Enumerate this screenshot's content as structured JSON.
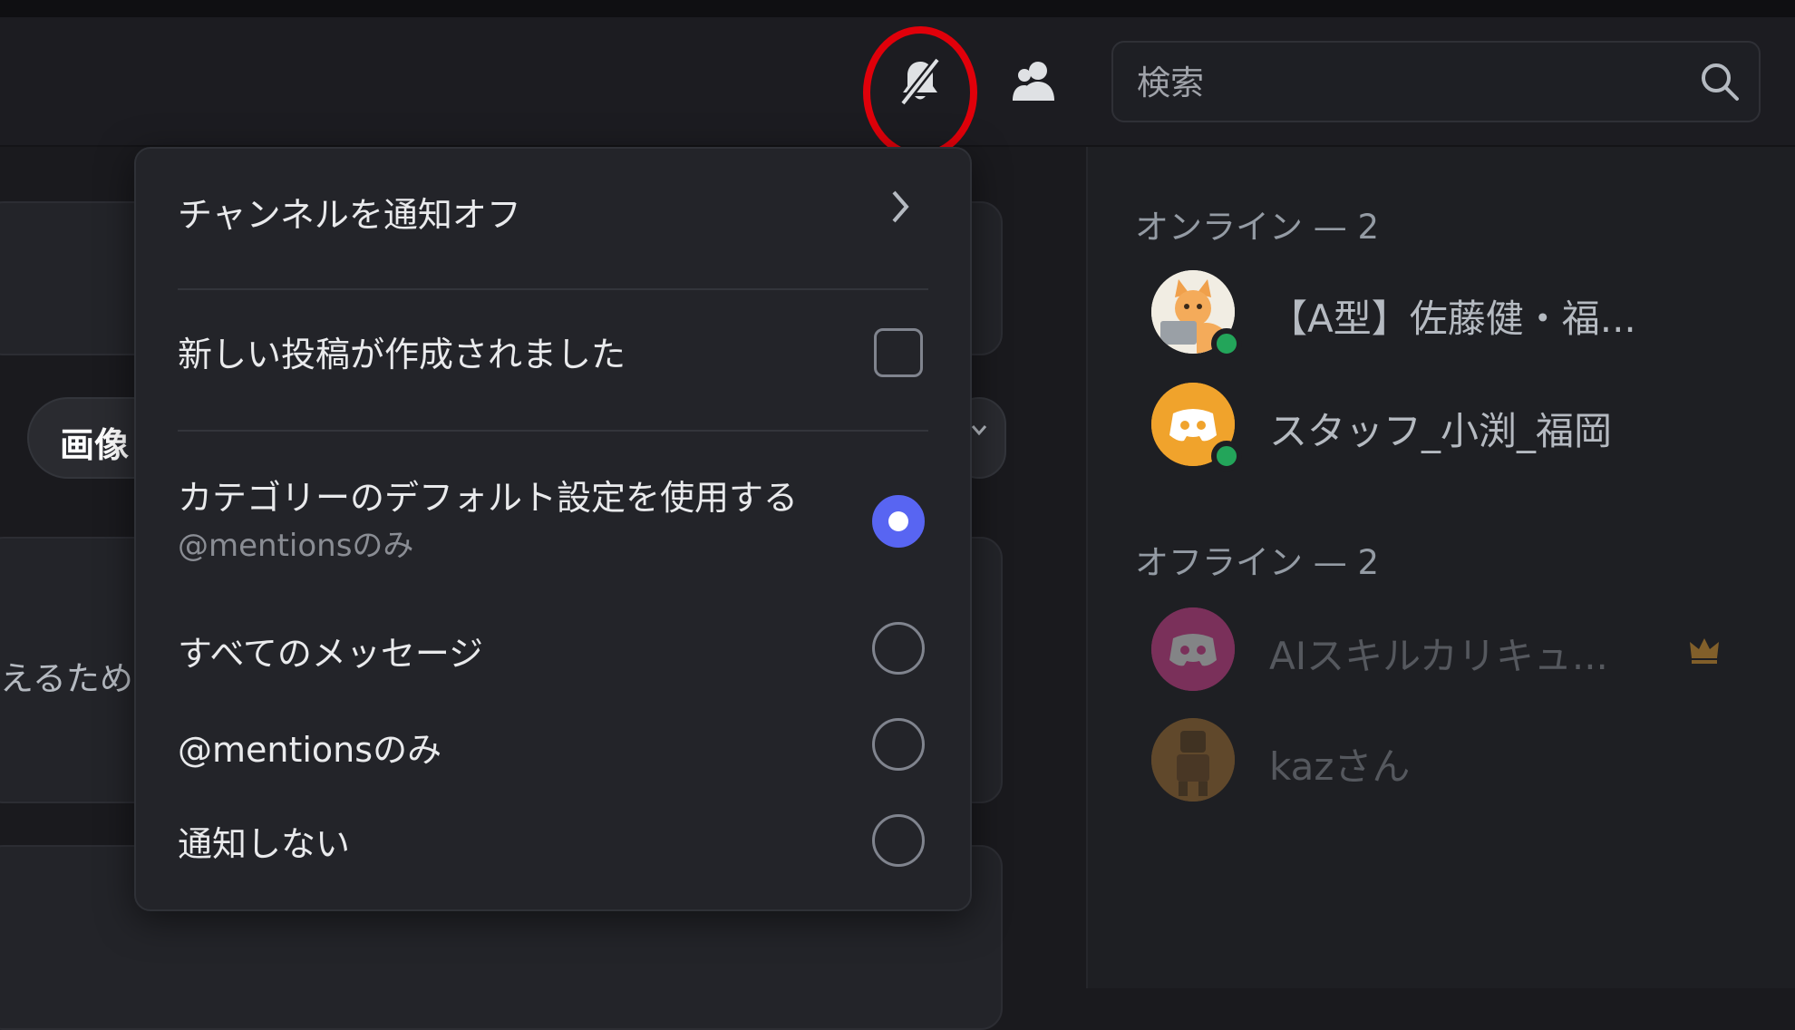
{
  "header": {
    "search_placeholder": "検索"
  },
  "main": {
    "chip_label": "画像",
    "peek_text": "えるため"
  },
  "menu": {
    "items": [
      {
        "label": "チャンネルを通知オフ",
        "type": "submenu"
      },
      {
        "label": "新しい投稿が作成されました",
        "type": "checkbox",
        "checked": false
      },
      {
        "label": "カテゴリーのデフォルト設定を使用する",
        "sublabel": "@mentionsのみ",
        "type": "radio",
        "checked": true
      },
      {
        "label": "すべてのメッセージ",
        "type": "radio",
        "checked": false
      },
      {
        "label": "@mentionsのみ",
        "type": "radio",
        "checked": false
      },
      {
        "label": "通知しない",
        "type": "radio",
        "checked": false
      }
    ]
  },
  "sidebar": {
    "online_label": "オンライン — 2",
    "offline_label": "オフライン — 2",
    "online_members": [
      {
        "name": "【A型】佐藤健・福...",
        "status": "online"
      },
      {
        "name": "スタッフ_小渕_福岡",
        "status": "online"
      }
    ],
    "offline_members": [
      {
        "name": "AIスキルカリキュ...",
        "owner": true
      },
      {
        "name": "kazさん"
      }
    ]
  },
  "colors": {
    "accent": "#5865f2",
    "online": "#23a55a",
    "highlight_ring": "#e0000a",
    "discord_orange": "#f0a32c",
    "discord_pink": "#eb459e"
  }
}
